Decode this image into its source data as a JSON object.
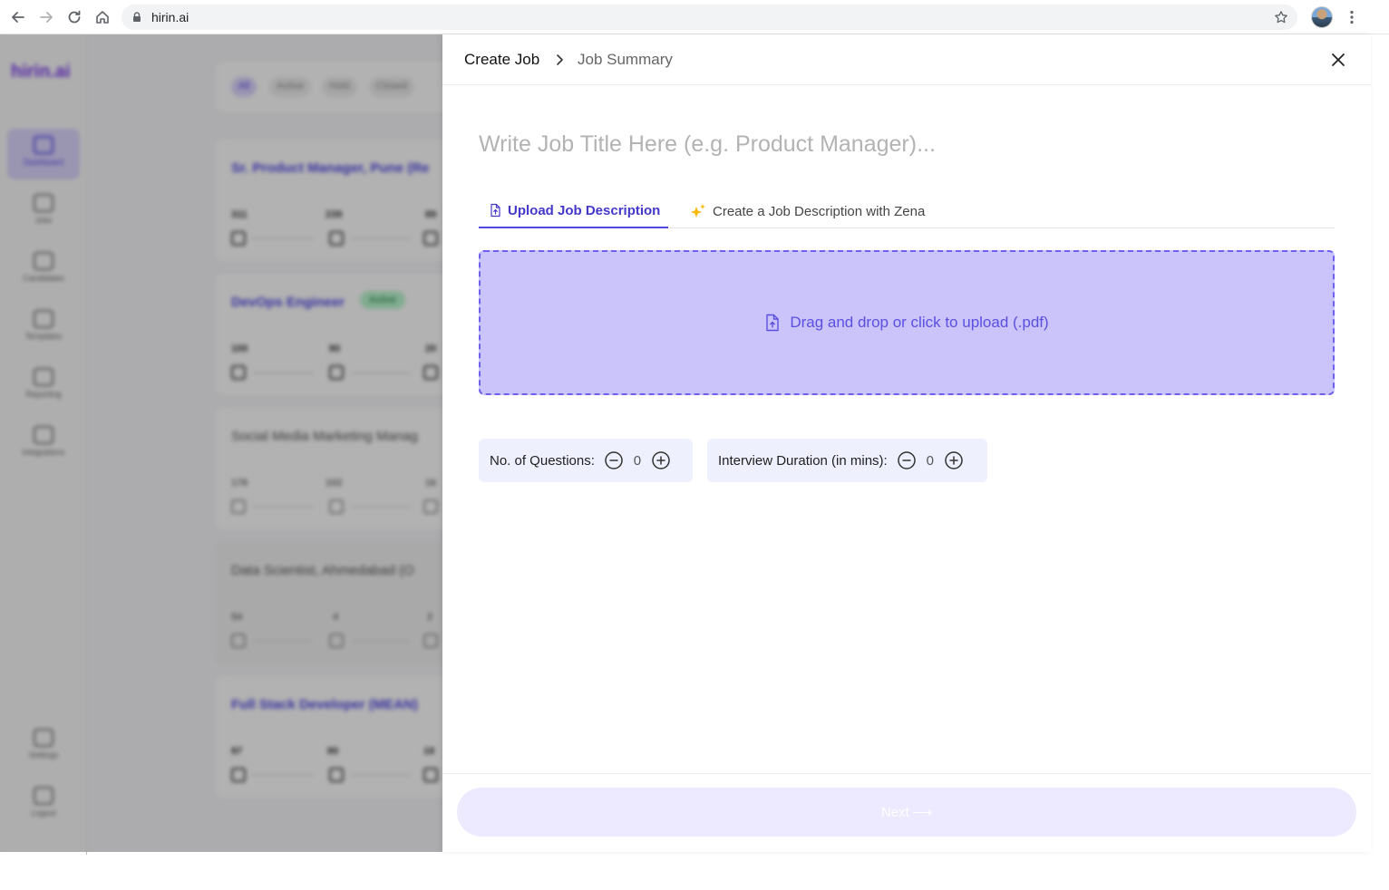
{
  "browser": {
    "url": "hirin.ai"
  },
  "background": {
    "logo": "hirin.ai",
    "sidebar": [
      "Dashboard",
      "Jobs",
      "Candidates",
      "Templates",
      "Reporting",
      "Integrations",
      "Settings",
      "Logout"
    ],
    "filters": [
      "All",
      "Active",
      "Hold",
      "Closed"
    ],
    "jobs": [
      {
        "title": "Sr. Product Manager, Pune (Re",
        "badge": "",
        "stats": [
          "311",
          "239",
          "89"
        ]
      },
      {
        "title": "DevOps Engineer",
        "badge": "Active",
        "stats": [
          "100",
          "80",
          "20"
        ]
      },
      {
        "title": "Social Media Marketing Manag",
        "badge": "",
        "stats": [
          "176",
          "102",
          "16"
        ]
      },
      {
        "title": "Data Scientist, Ahmedabad (O",
        "badge": "",
        "stats": [
          "54",
          "4",
          "2"
        ]
      },
      {
        "title": "Full Stack Developer (MEAN)",
        "badge": "",
        "stats": [
          "87",
          "80",
          "18"
        ]
      }
    ]
  },
  "drawer": {
    "breadcrumb": {
      "create": "Create Job",
      "summary": "Job Summary"
    },
    "job_title_placeholder": "Write Job Title Here (e.g. Product Manager)...",
    "tabs": {
      "upload": "Upload Job Description",
      "zena": "Create a Job Description with Zena",
      "active": "upload"
    },
    "dropzone_text": "Drag and drop or click to upload (.pdf)",
    "questions": {
      "label": "No. of Questions:",
      "value": "0"
    },
    "duration": {
      "label": "Interview Duration (in mins):",
      "value": "0"
    },
    "next_label": "Next",
    "next_arrow": "⟶"
  },
  "colors": {
    "accent": "#4f46e5",
    "dropzone_bg": "#cac4fb",
    "next_bg": "#ede9fe",
    "stepper_bg": "#eef0fe"
  }
}
